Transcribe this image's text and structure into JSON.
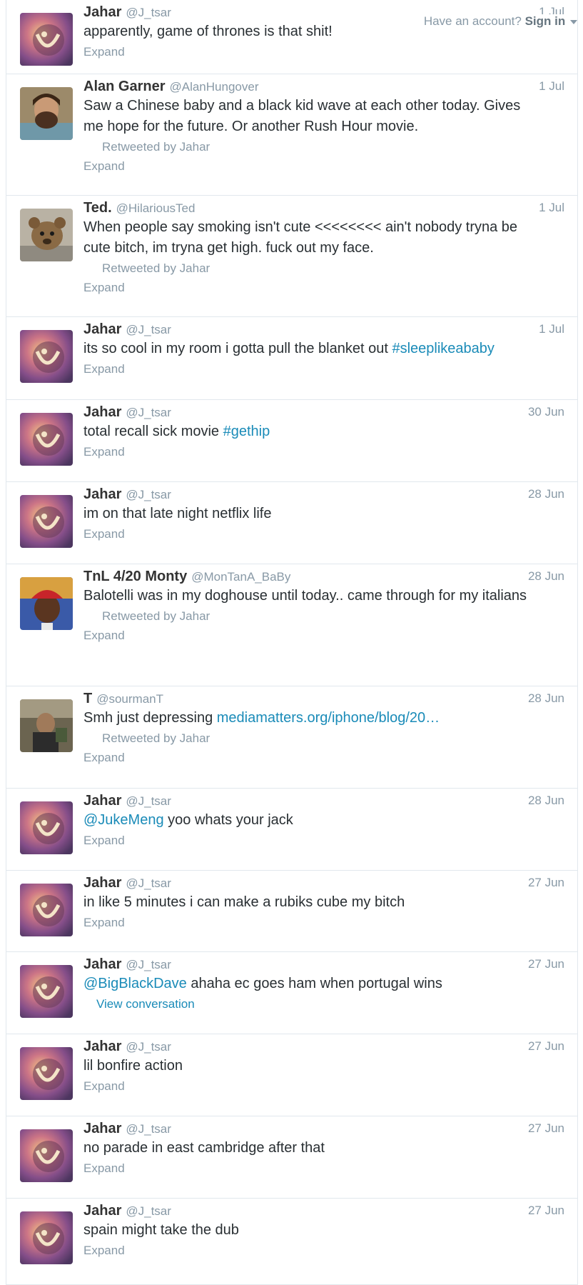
{
  "topbar": {
    "have_account": "Have an account?",
    "sign_in": "Sign in"
  },
  "tweets": [
    {
      "name": "Jahar",
      "handle": "@J_tsar",
      "time": "1 Jul",
      "text": "apparently, game of thrones is that shit!",
      "expand": "Expand",
      "avatar": "jahar"
    },
    {
      "name": "Alan Garner",
      "handle": "@AlanHungover",
      "time": "1 Jul",
      "text": "Saw a Chinese baby and a black kid wave at each other today. Gives me hope for the future. Or another Rush Hour movie.",
      "retweeted": "Retweeted by Jahar",
      "expand": "Expand",
      "avatar": "alan"
    },
    {
      "name": "Ted.",
      "handle": "@HilariousTed",
      "time": "1 Jul",
      "text": "When people say smoking isn't cute <<<<<<<< ain't nobody tryna be cute bitch, im tryna get high. fuck out my face.",
      "retweeted": "Retweeted by Jahar",
      "expand": "Expand",
      "avatar": "ted"
    },
    {
      "name": "Jahar",
      "handle": "@J_tsar",
      "time": "1 Jul",
      "text": "its so cool in my room i gotta pull the blanket out ",
      "link": "#sleeplikeababy",
      "expand": "Expand",
      "avatar": "jahar"
    },
    {
      "name": "Jahar",
      "handle": "@J_tsar",
      "time": "30 Jun",
      "text": "total recall sick movie ",
      "link": "#gethip",
      "expand": "Expand",
      "avatar": "jahar"
    },
    {
      "name": "Jahar",
      "handle": "@J_tsar",
      "time": "28 Jun",
      "text": "im on that late night netflix life",
      "expand": "Expand",
      "avatar": "jahar"
    },
    {
      "name": "TnL 4/20 Monty",
      "handle": "@MonTanA_BaBy",
      "time": "28 Jun",
      "text": "Balotelli was in my doghouse until today.. came through for my italians",
      "retweeted": "Retweeted by Jahar",
      "expand": "Expand",
      "avatar": "monty"
    },
    {
      "name": "T",
      "handle": "@sourmanT",
      "time": "28 Jun",
      "text": "Smh just depressing ",
      "link": "mediamatters.org/iphone/blog/20…",
      "retweeted": "Retweeted by Jahar",
      "expand": "Expand",
      "avatar": "t"
    },
    {
      "name": "Jahar",
      "handle": "@J_tsar",
      "time": "28 Jun",
      "lead": "@JukeMeng",
      "text": " yoo whats your jack",
      "expand": "Expand",
      "avatar": "jahar"
    },
    {
      "name": "Jahar",
      "handle": "@J_tsar",
      "time": "27 Jun",
      "text": "in like 5 minutes i can make a rubiks cube my bitch",
      "expand": "Expand",
      "avatar": "jahar"
    },
    {
      "name": "Jahar",
      "handle": "@J_tsar",
      "time": "27 Jun",
      "lead": "@BigBlackDave",
      "text": " ahaha ec goes ham when portugal wins",
      "view_conversation": "View conversation",
      "avatar": "jahar"
    },
    {
      "name": "Jahar",
      "handle": "@J_tsar",
      "time": "27 Jun",
      "text": "lil bonfire action",
      "expand": "Expand",
      "avatar": "jahar"
    },
    {
      "name": "Jahar",
      "handle": "@J_tsar",
      "time": "27 Jun",
      "text": "no parade in east cambridge after that",
      "expand": "Expand",
      "avatar": "jahar"
    },
    {
      "name": "Jahar",
      "handle": "@J_tsar",
      "time": "27 Jun",
      "text": "spain might take the dub",
      "expand": "Expand",
      "avatar": "jahar"
    }
  ]
}
